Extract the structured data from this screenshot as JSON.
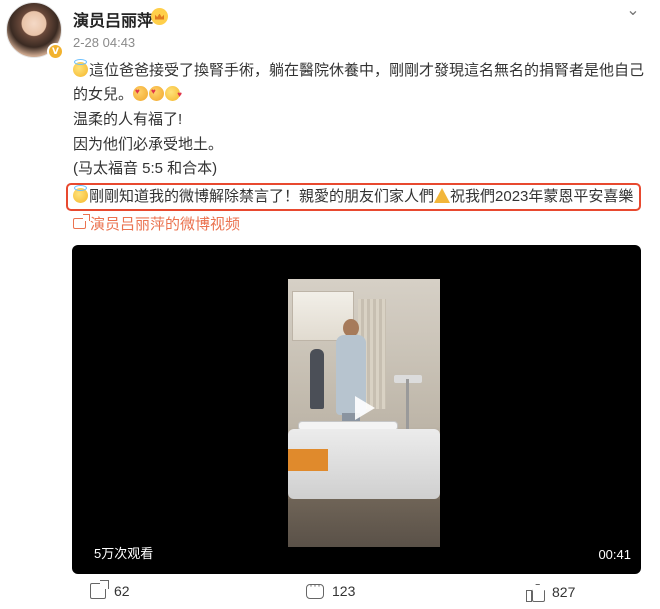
{
  "post": {
    "author": "演员吕丽萍",
    "time": "2-28 04:43",
    "lines": {
      "l1": "這位爸爸接受了換腎手術，躺在醫院休養中，剛剛才發現這名無名的捐腎者是他自己",
      "l2": "的女兒。",
      "l3": "温柔的人有福了!",
      "l4": "因为他们必承受地土。",
      "l5": "(马太福音 5:5 和合本)",
      "l6a": "剛剛知道我的微博解除禁言了！親愛的朋友们家人們",
      "l6b": "祝我們2023年蒙恩平安喜樂"
    },
    "video_link": "演员吕丽萍的微博视频"
  },
  "video": {
    "views": "5万次观看",
    "duration": "00:41"
  },
  "actions": {
    "share_count": "62",
    "comment_count": "123",
    "like_count": "827"
  },
  "colors": {
    "highlight_border": "#e8492f",
    "link": "#eb7350",
    "vip_badge": "#ffcf4a"
  },
  "icons": [
    "menu-icon",
    "verified-icon",
    "vip-icon",
    "video-link-icon",
    "play-icon",
    "share-icon",
    "comment-icon",
    "like-icon"
  ]
}
